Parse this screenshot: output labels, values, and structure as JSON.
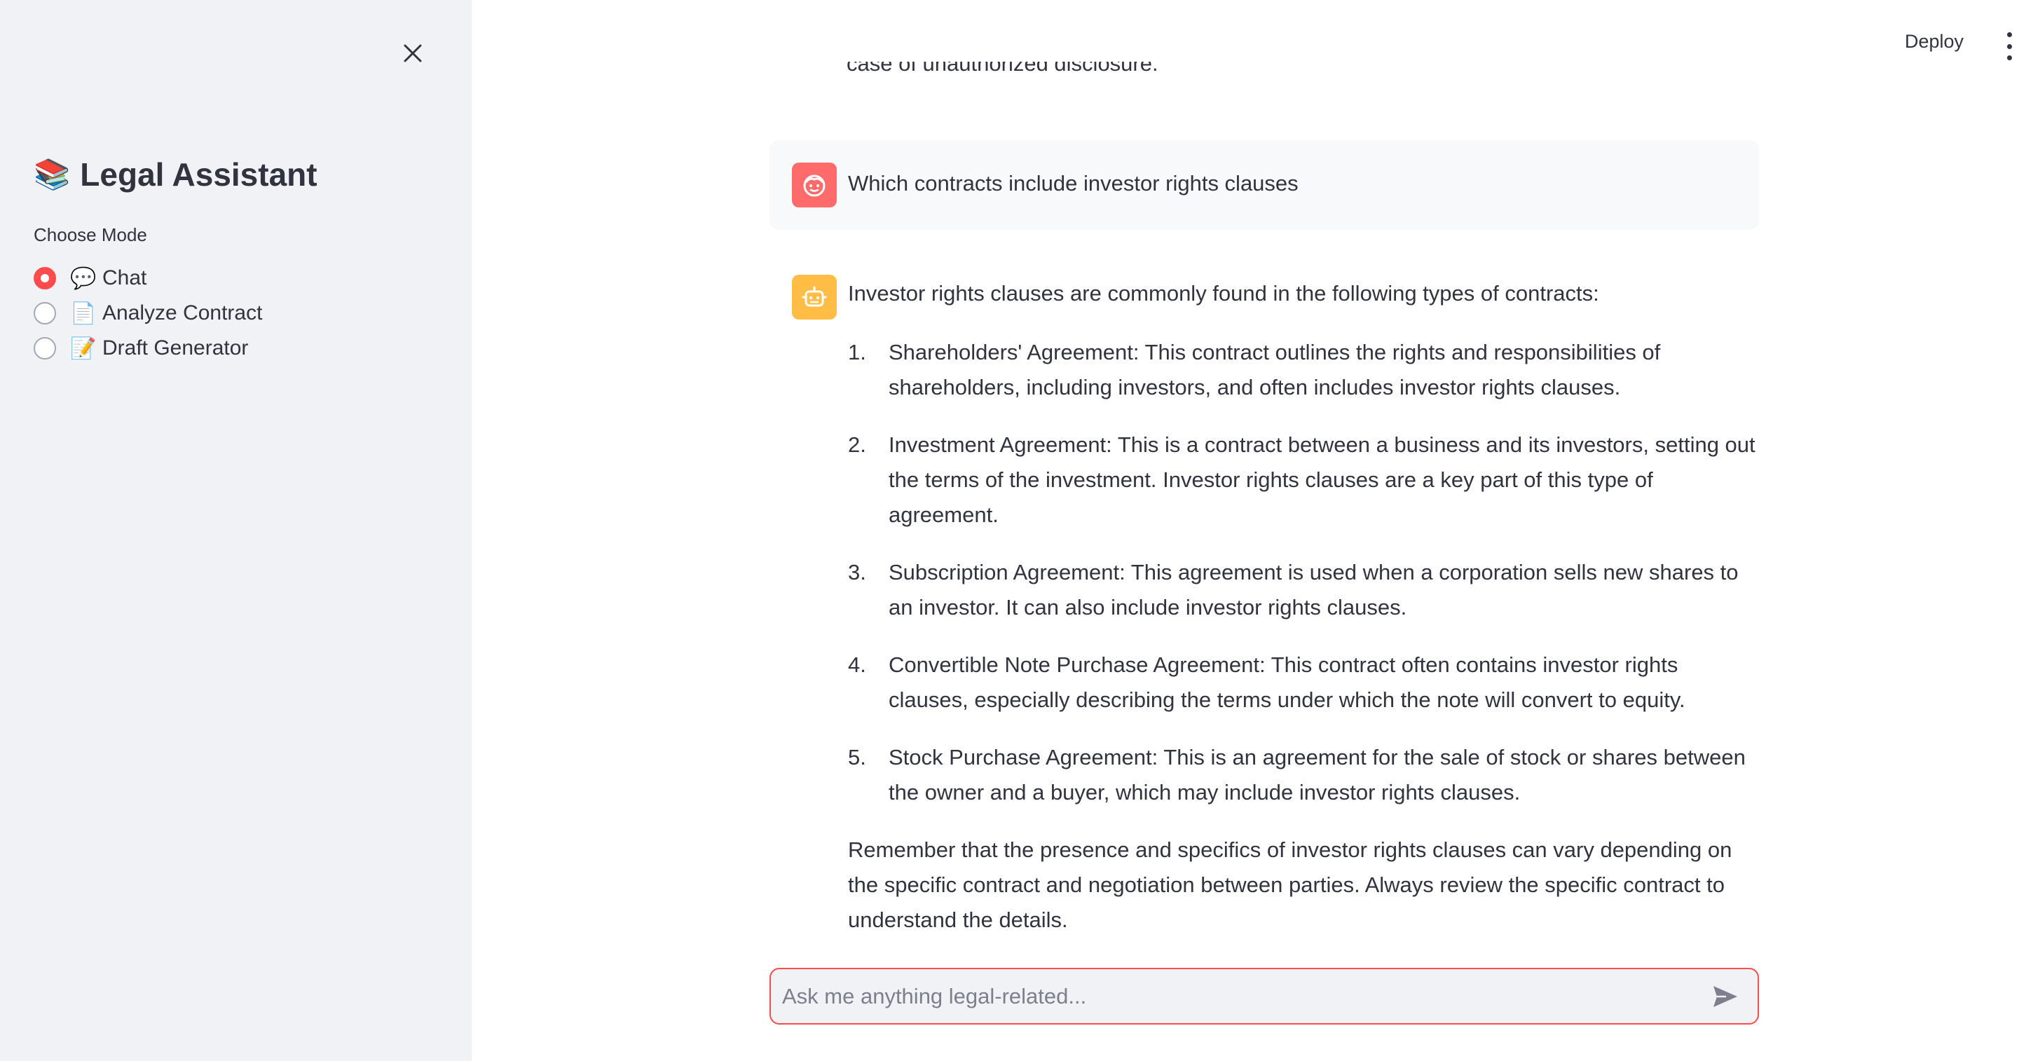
{
  "sidebar": {
    "title_emoji": "📚",
    "title": "Legal Assistant",
    "mode_label": "Choose Mode",
    "modes": [
      {
        "emoji": "💬",
        "label": "Chat",
        "selected": true
      },
      {
        "emoji": "📄",
        "label": "Analyze Contract",
        "selected": false
      },
      {
        "emoji": "📝",
        "label": "Draft Generator",
        "selected": false
      }
    ]
  },
  "header": {
    "deploy_label": "Deploy",
    "menu_icon": "more-vertical-icon"
  },
  "chat": {
    "partial_previous_text": "case of unauthorized disclosure.",
    "user_message": "Which contracts include investor rights clauses",
    "assistant_intro": "Investor rights clauses are commonly found in the following types of contracts:",
    "assistant_list": [
      {
        "num": "1.",
        "text": "Shareholders' Agreement: This contract outlines the rights and responsibilities of shareholders, including investors, and often includes investor rights clauses."
      },
      {
        "num": "2.",
        "text": "Investment Agreement: This is a contract between a business and its investors, setting out the terms of the investment. Investor rights clauses are a key part of this type of agreement."
      },
      {
        "num": "3.",
        "text": "Subscription Agreement: This agreement is used when a corporation sells new shares to an investor. It can also include investor rights clauses."
      },
      {
        "num": "4.",
        "text": "Convertible Note Purchase Agreement: This contract often contains investor rights clauses, especially describing the terms under which the note will convert to equity."
      },
      {
        "num": "5.",
        "text": "Stock Purchase Agreement: This is an agreement for the sale of stock or shares between the owner and a buyer, which may include investor rights clauses."
      }
    ],
    "assistant_outro": "Remember that the presence and specifics of investor rights clauses can vary depending on the specific contract and negotiation between parties. Always review the specific contract to understand the details."
  },
  "input": {
    "placeholder": "Ask me anything legal-related...",
    "value": ""
  },
  "colors": {
    "accent": "#ff4b4b",
    "sidebar_bg": "#f0f2f6",
    "user_avatar": "#ff6b6b",
    "bot_avatar": "#ffbd45",
    "text": "#31333f"
  }
}
